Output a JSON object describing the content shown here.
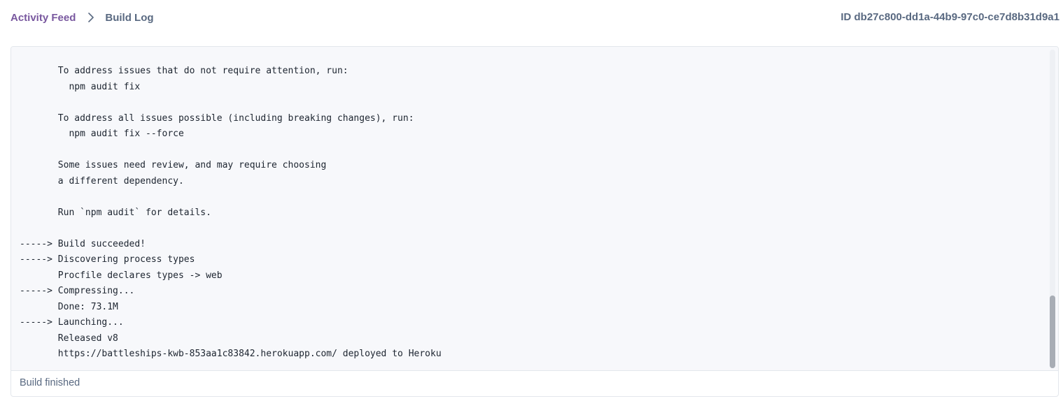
{
  "breadcrumb": {
    "parent_label": "Activity Feed",
    "separator_icon": "chevron-right-icon",
    "current_label": "Build Log"
  },
  "build_id": "ID db27c800-dd1a-44b9-97c0-ce7d8b31d9a1",
  "log": {
    "lines": [
      "       To address issues that do not require attention, run:",
      "         npm audit fix",
      "",
      "       To address all issues possible (including breaking changes), run:",
      "         npm audit fix --force",
      "",
      "       Some issues need review, and may require choosing",
      "       a different dependency.",
      "",
      "       Run `npm audit` for details.",
      "",
      "-----> Build succeeded!",
      "-----> Discovering process types",
      "       Procfile declares types -> web",
      "-----> Compressing...",
      "       Done: 73.1M",
      "-----> Launching...",
      "       Released v8",
      "       https://battleships-kwb-853aa1c83842.herokuapp.com/ deployed to Heroku"
    ]
  },
  "status": "Build finished",
  "colors": {
    "accent": "#79589f",
    "muted_text": "#596981",
    "log_background": "#f7f8fb",
    "border": "#e3e7ec"
  }
}
